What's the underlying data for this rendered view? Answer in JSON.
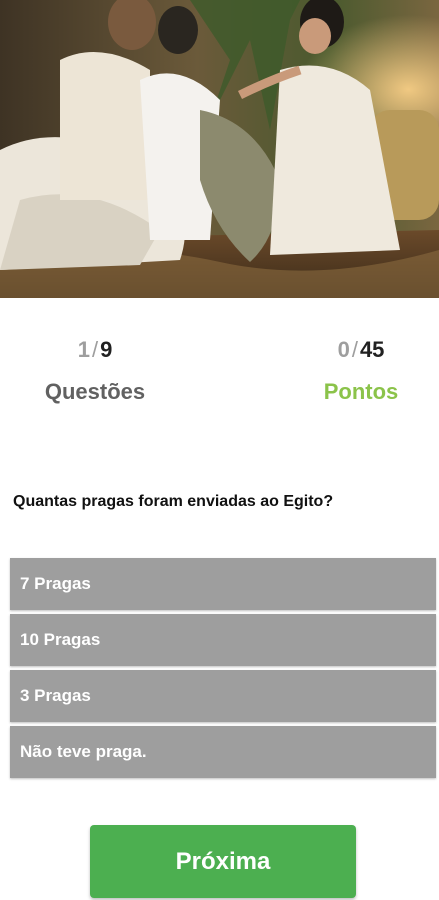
{
  "quiz": {
    "progress": {
      "current": "1",
      "separator": "/",
      "total": "9",
      "label": "Questões"
    },
    "score": {
      "current": "0",
      "separator": "/",
      "total": "45",
      "label": "Pontos"
    },
    "question": "Quantas pragas foram enviadas ao Egito?",
    "options": [
      {
        "label": "7 Pragas"
      },
      {
        "label": "10 Pragas"
      },
      {
        "label": "3 Pragas"
      },
      {
        "label": "Não teve praga."
      }
    ],
    "next_label": "Próxima"
  },
  "colors": {
    "accent_green": "#8bc34a",
    "button_green": "#4caf50",
    "option_gray": "#9e9e9e"
  }
}
